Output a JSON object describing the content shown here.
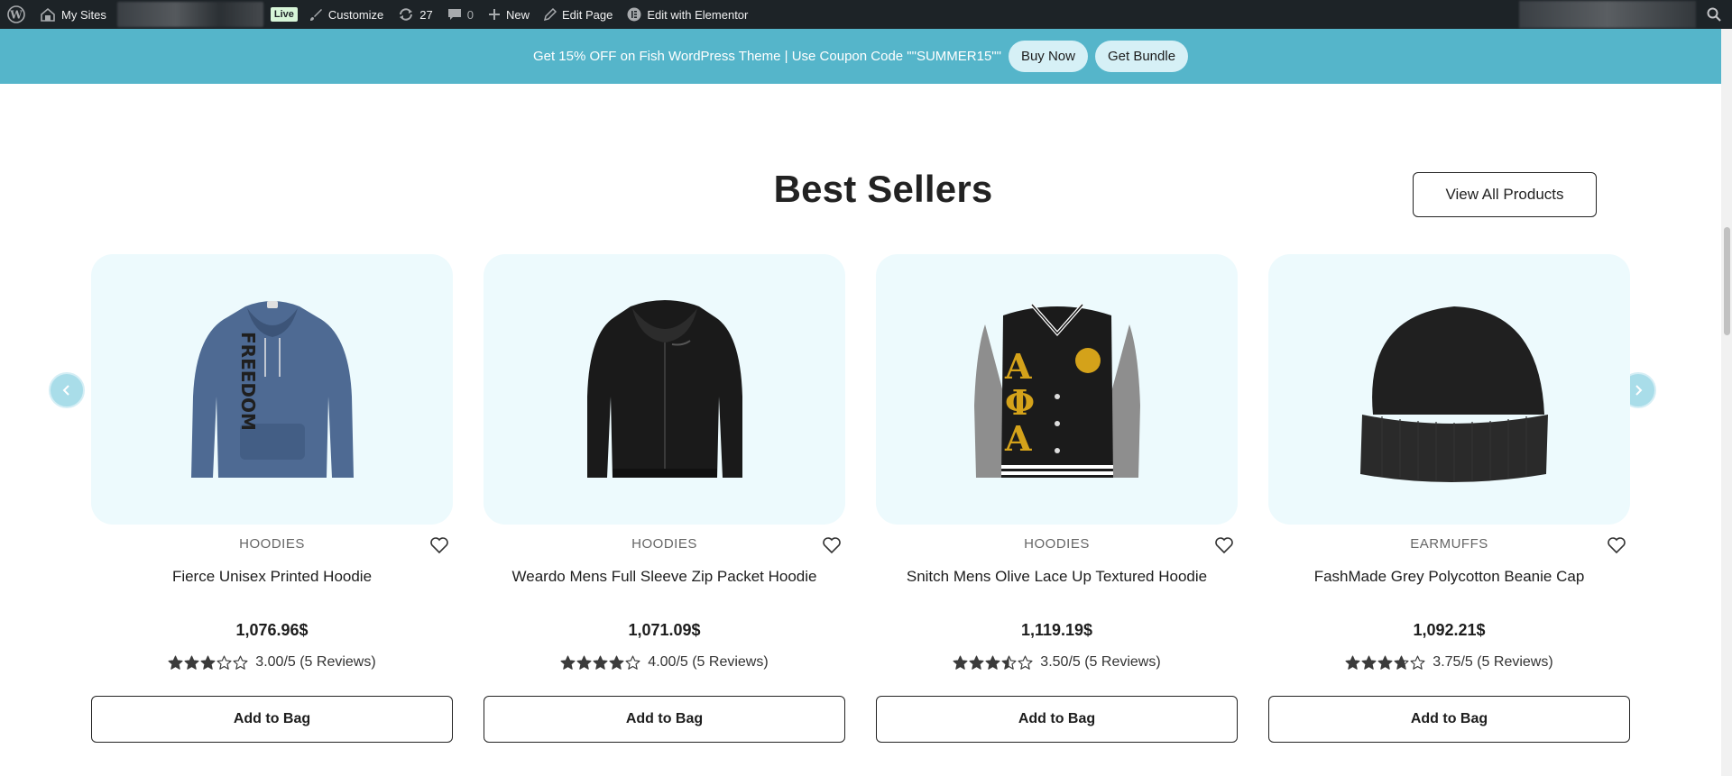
{
  "adminbar": {
    "my_sites": "My Sites",
    "live_badge": "Live",
    "customize": "Customize",
    "updates_count": "27",
    "comments_count": "0",
    "new_label": "New",
    "edit_page": "Edit Page",
    "edit_elementor": "Edit with Elementor"
  },
  "promo": {
    "text": "Get 15% OFF on Fish WordPress Theme | Use Coupon Code \"\"SUMMER15\"\"",
    "buy_now": "Buy Now",
    "get_bundle": "Get Bundle",
    "bg_color": "#55b5ca"
  },
  "section": {
    "title": "Best Sellers",
    "view_all": "View All Products"
  },
  "products": [
    {
      "category": "HOODIES",
      "name": "Fierce Unisex Printed Hoodie",
      "price": "1,076.96$",
      "rating": 3.0,
      "rating_text": "3.00/5 (5 Reviews)",
      "button": "Add to Bag",
      "image_icon": "blue-printed-hoodie"
    },
    {
      "category": "HOODIES",
      "name": "Weardo Mens Full Sleeve Zip Packet Hoodie",
      "price": "1,071.09$",
      "rating": 4.0,
      "rating_text": "4.00/5 (5 Reviews)",
      "button": "Add to Bag",
      "image_icon": "black-zip-hoodie"
    },
    {
      "category": "HOODIES",
      "name": "Snitch Mens Olive Lace Up Textured Hoodie",
      "price": "1,119.19$",
      "rating": 3.5,
      "rating_text": "3.50/5 (5 Reviews)",
      "button": "Add to Bag",
      "image_icon": "varsity-jacket"
    },
    {
      "category": "EARMUFFS",
      "name": "FashMade Grey Polycotton Beanie Cap",
      "price": "1,092.21$",
      "rating": 3.75,
      "rating_text": "3.75/5 (5 Reviews)",
      "button": "Add to Bag",
      "image_icon": "black-beanie"
    }
  ],
  "accent_color": "#a9dde9",
  "card_bg_color": "#edfafd"
}
